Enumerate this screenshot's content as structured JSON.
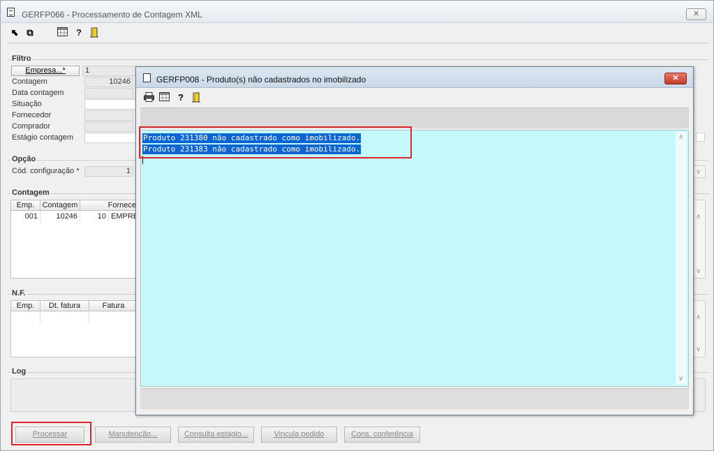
{
  "main": {
    "title": "GERFP066 - Processamento de Contagem XML",
    "close_label": "✕",
    "toolbar_icons": [
      "arrow-select-icon",
      "copy-windows-icon",
      "calculator-icon",
      "help-icon",
      "exit-door-icon"
    ]
  },
  "filtro": {
    "label": "Filtro",
    "empresa_button": "Empresa...*",
    "empresa_value": "1",
    "contagem_label": "Contagem",
    "contagem_value": "10246",
    "data_contagem_label": "Data contagem",
    "situacao_label": "Situação",
    "fornecedor_label": "Fornecedor",
    "comprador_label": "Comprador",
    "estagio_label": "Estágio contagem"
  },
  "opcao": {
    "label": "Opção",
    "cod_config_label": "Cód. configuração *",
    "cod_config_value": "1"
  },
  "contagem_grid": {
    "label": "Contagem",
    "columns": [
      "Emp.",
      "Contagem",
      "Fornece"
    ],
    "rows": [
      [
        "001",
        "10246",
        "10",
        "EMPRES"
      ]
    ]
  },
  "nf_grid": {
    "label": "N.F.",
    "columns": [
      "Emp.",
      "Dt. fatura",
      "Fatura"
    ]
  },
  "log": {
    "label": "Log"
  },
  "buttons": {
    "processar": "Processar",
    "manutencao": "Manutenção...",
    "consulta_estagio": "Consulta estágio...",
    "vincula_pedido": "Vincula pedido",
    "cons_conferencia": "Cons. conferência"
  },
  "dialog": {
    "title": "GERFP008 - Produto(s) não cadastrados no imobilizado",
    "close_label": "✕",
    "toolbar_icons": [
      "printer-icon",
      "calculator-icon",
      "help-icon",
      "exit-door-icon"
    ],
    "lines": [
      "Produto 231380 não cadastrado como imobilizado.",
      "Produto 231383 não cadastrado como imobilizado."
    ]
  },
  "colors": {
    "highlight_red": "#e0242b",
    "selection_blue": "#0a64d2",
    "text_area_bg": "#c4f8fb",
    "dialog_close_red": "#c43b2a"
  }
}
